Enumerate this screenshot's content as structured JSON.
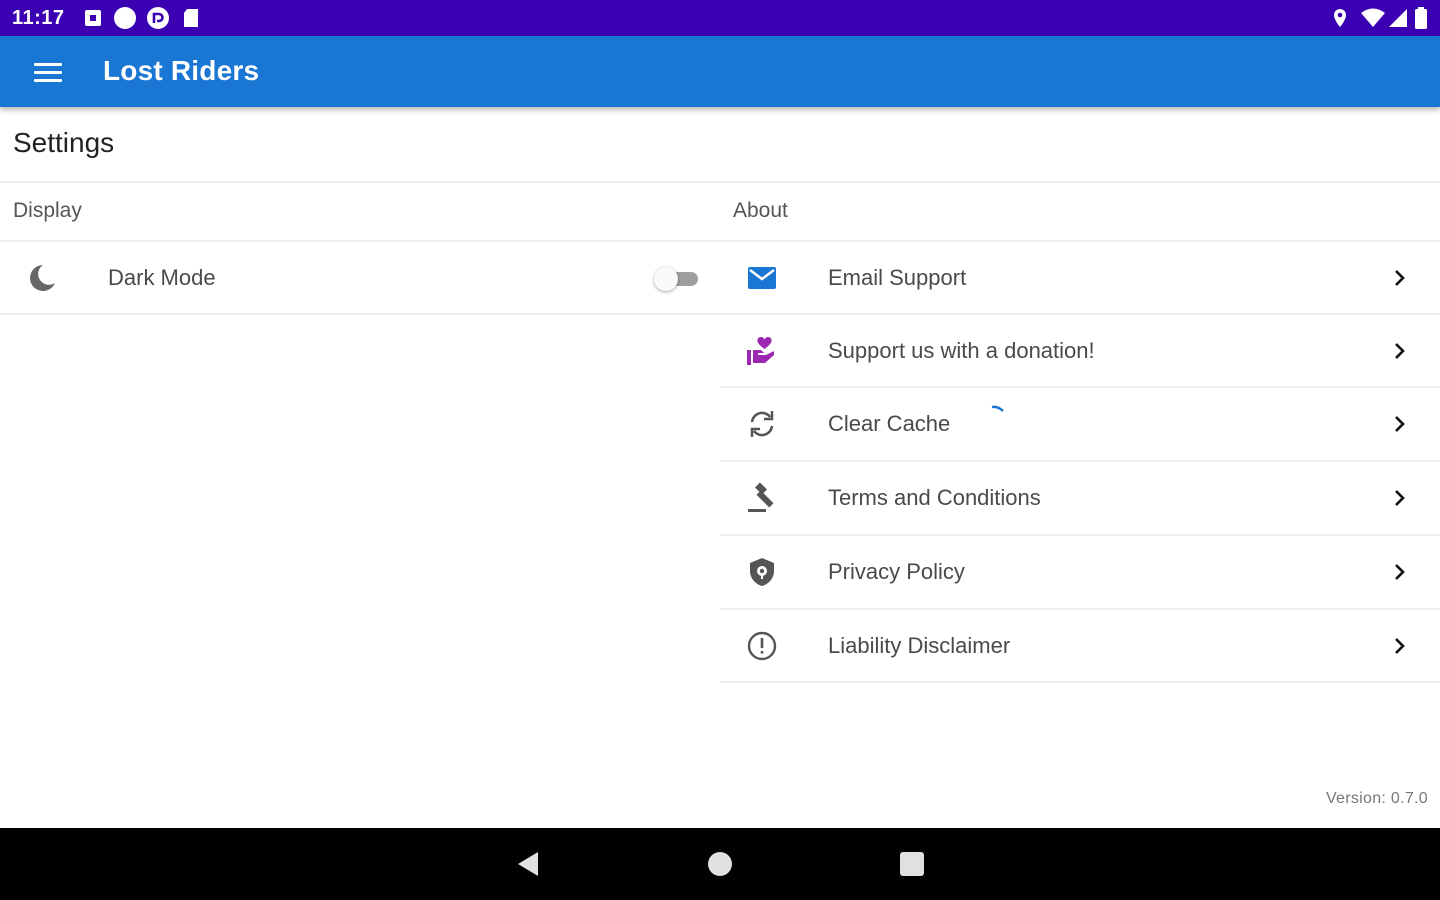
{
  "status_bar": {
    "time": "11:17",
    "left_icons": [
      "notification-square-icon",
      "circle-icon",
      "pocket-casts-icon",
      "sd-card-icon"
    ],
    "right_icons": [
      "location-icon",
      "wifi-icon",
      "cell-signal-icon",
      "battery-icon"
    ]
  },
  "app_bar": {
    "title": "Lost Riders",
    "menu_icon": "menu-icon",
    "color": "#1976d2"
  },
  "page": {
    "title": "Settings"
  },
  "display_section": {
    "label": "Display",
    "items": [
      {
        "label": "Dark Mode",
        "icon": "moon-icon",
        "toggle_on": false
      }
    ]
  },
  "about_section": {
    "label": "About",
    "items": [
      {
        "label": "Email Support",
        "icon": "email-icon",
        "icon_color": "#1976d2"
      },
      {
        "label": "Support us with a donation!",
        "icon": "donation-hand-heart-icon",
        "icon_color": "#9c27b0"
      },
      {
        "label": "Clear Cache",
        "icon": "sync-icon"
      },
      {
        "label": "Terms and Conditions",
        "icon": "gavel-icon"
      },
      {
        "label": "Privacy Policy",
        "icon": "shield-lock-icon"
      },
      {
        "label": "Liability Disclaimer",
        "icon": "exclamation-circle-icon"
      }
    ]
  },
  "footer": {
    "version": "Version: 0.7.0"
  },
  "nav_bar": {
    "buttons": [
      "back-icon",
      "home-icon",
      "recents-icon"
    ]
  }
}
